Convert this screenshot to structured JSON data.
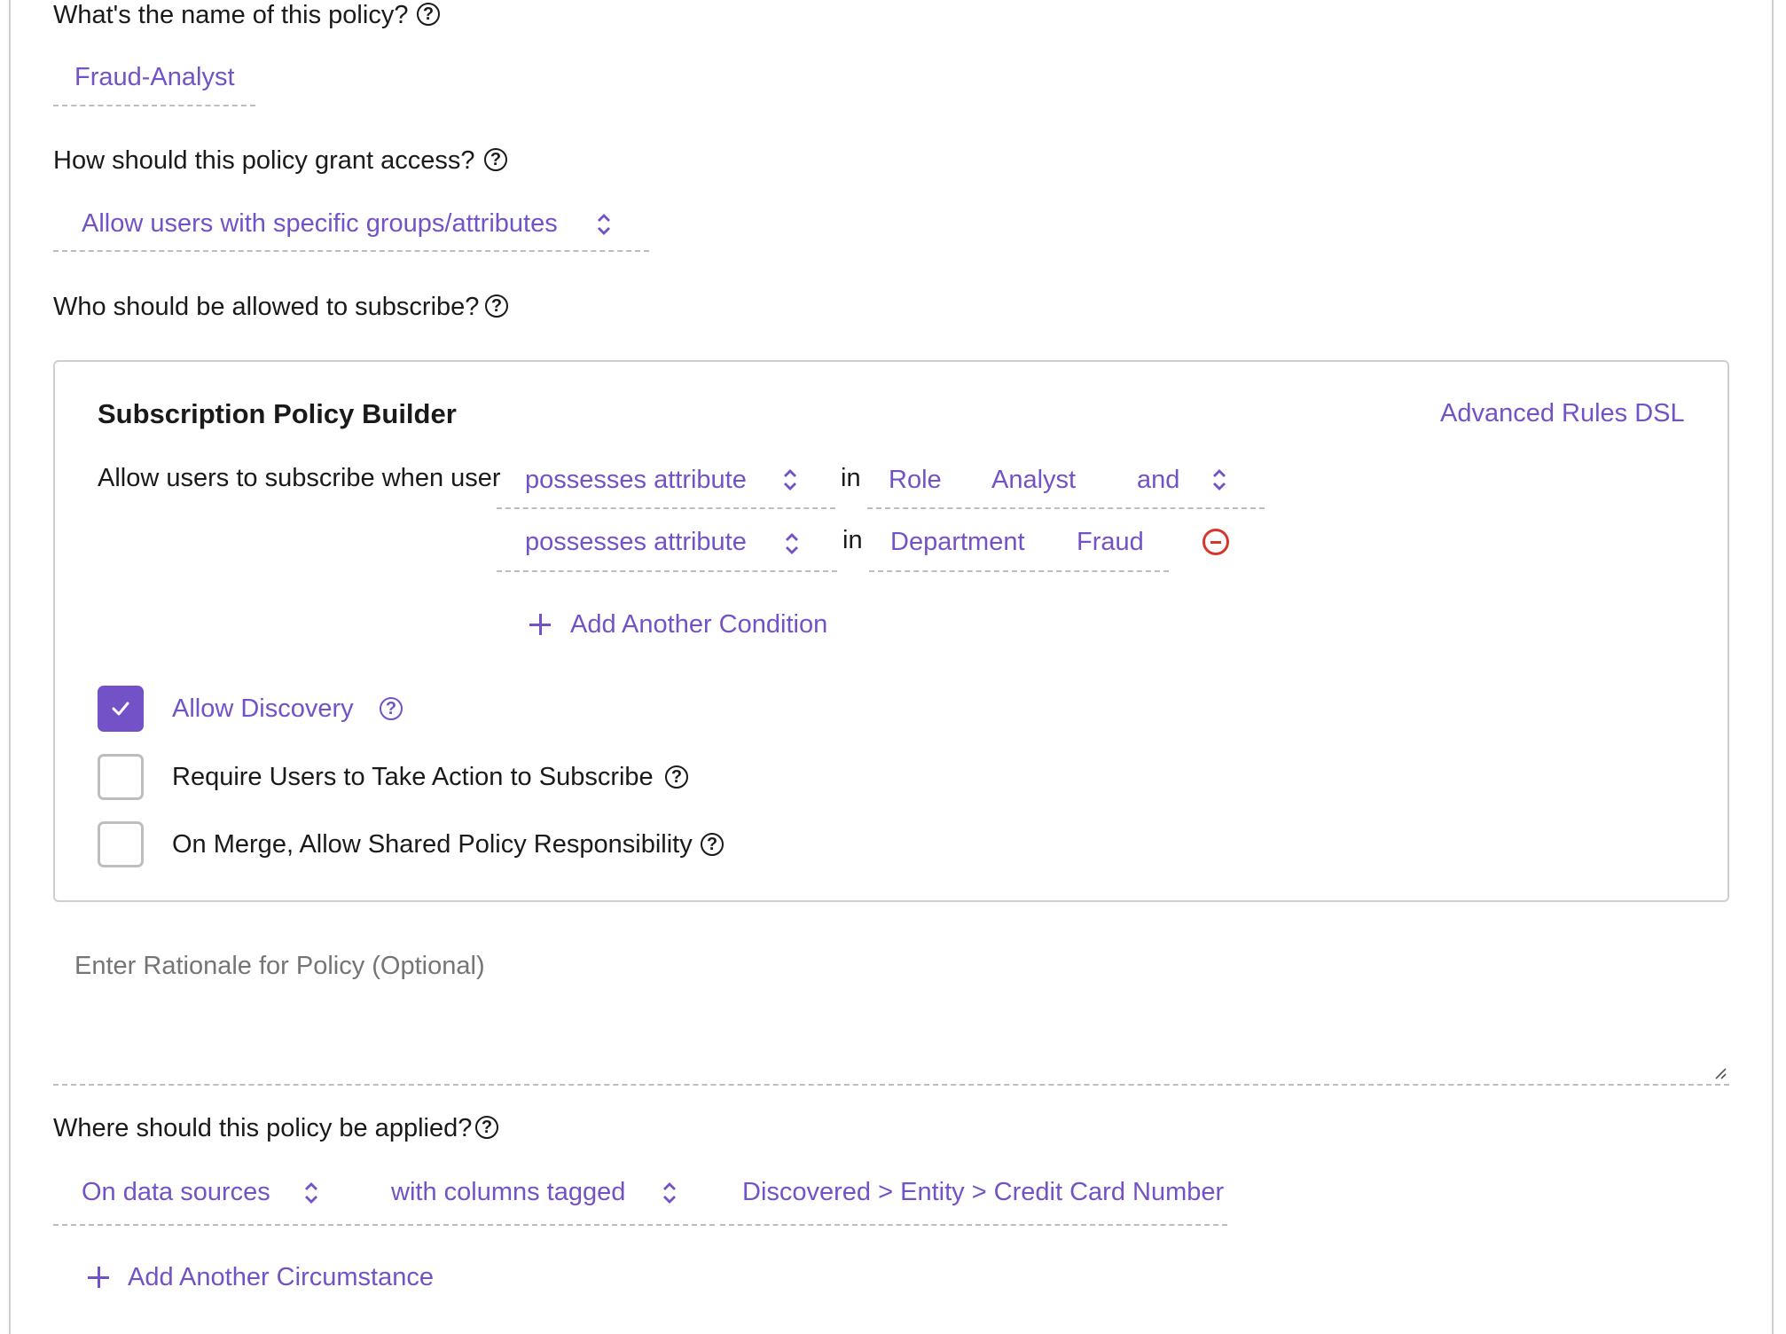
{
  "policy_name": {
    "question": "What's the name of this policy?",
    "value": "Fraud-Analyst"
  },
  "grant_access": {
    "question": "How should this policy grant access?",
    "selected": "Allow users with specific groups/attributes"
  },
  "subscribe": {
    "question": "Who should be allowed to subscribe?"
  },
  "builder": {
    "title": "Subscription Policy Builder",
    "advanced_link": "Advanced Rules DSL",
    "intro": "Allow users to subscribe when user",
    "conditions": [
      {
        "operator": "possesses attribute",
        "in": "in",
        "attribute": "Role",
        "value": "Analyst",
        "conjunction": "and"
      },
      {
        "operator": "possesses attribute",
        "in": "in",
        "attribute": "Department",
        "value": "Fraud"
      }
    ],
    "add_condition": "Add Another Condition",
    "options": [
      {
        "label": "Allow Discovery",
        "checked": true
      },
      {
        "label": "Require Users to Take Action to Subscribe",
        "checked": false
      },
      {
        "label": "On Merge, Allow Shared Policy Responsibility",
        "checked": false
      }
    ]
  },
  "rationale": {
    "placeholder": "Enter Rationale for Policy (Optional)"
  },
  "applied": {
    "question": "Where should this policy be applied?",
    "scope": "On data sources",
    "filter": "with columns tagged",
    "tag": "Discovered > Entity > Credit Card Number",
    "add_circumstance": "Add Another Circumstance"
  },
  "colors": {
    "accent": "#7352c7",
    "danger": "#d9362b",
    "text": "#1a1a1a",
    "border": "#cfcfcf"
  },
  "icons": {
    "help": "question-circle-icon",
    "select": "chevron-up-down-icon",
    "remove": "minus-circle-icon",
    "add": "plus-icon",
    "check": "checkmark-icon"
  }
}
